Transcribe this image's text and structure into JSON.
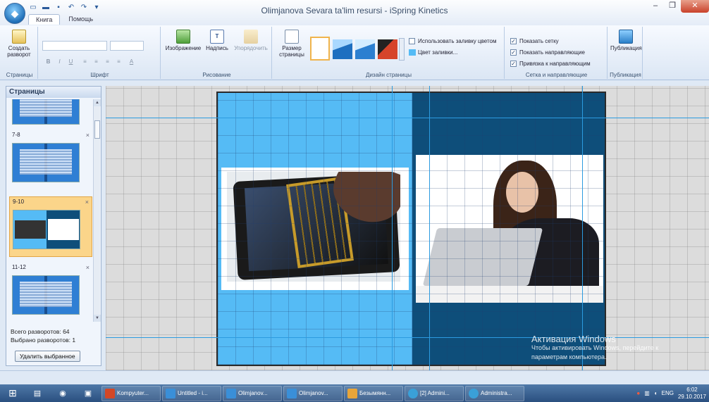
{
  "window": {
    "title": "Olimjanova Sevara ta'lim resursi - iSpring Kinetics",
    "min_label": "–",
    "max_label": "❐",
    "close_label": "✕"
  },
  "tabs": [
    "Книга",
    "Помощь"
  ],
  "ribbon": {
    "create_spread": "Создать разворот",
    "group_pages": "Страницы",
    "group_font": "Шрифт",
    "font_buttons": [
      "B",
      "I",
      "U"
    ],
    "image": "Изображение",
    "textbox": "Надпись",
    "arrange": "Упорядочить",
    "group_drawing": "Рисование",
    "page_size": "Размер страницы",
    "use_fill_color": "Использовать заливку цветом",
    "fill_color": "Цвет заливки...",
    "group_page_design": "Дизайн страницы",
    "show_grid": "Показать сетку",
    "show_guides": "Показать направляющие",
    "snap_guides": "Привязка к направляющим",
    "group_grid": "Сетка и направляющие",
    "publish": "Публикация",
    "group_publish": "Публикация"
  },
  "pages_panel": {
    "header": "Страницы",
    "items": [
      {
        "label": "7-8"
      },
      {
        "label": "9-10"
      },
      {
        "label": "11-12"
      }
    ],
    "close_glyph": "×",
    "total": "Всего разворотов: 64",
    "selected": "Выбрано разворотов: 1",
    "delete_button": "Удалить выбранное"
  },
  "watermark": {
    "line1": "Активация Windows",
    "line2": "Чтобы активировать Windows, перейдите к",
    "line3": "параметрам компьютера."
  },
  "taskbar": {
    "items": [
      {
        "label": "Kompyuter...",
        "color": "#d24726"
      },
      {
        "label": "Untitled - i...",
        "color": "#3a8fd8"
      },
      {
        "label": "Olimjanov...",
        "color": "#3a8fd8"
      },
      {
        "label": "Olimjanov...",
        "color": "#3a8fd8"
      },
      {
        "label": "Безымянн...",
        "color": "#e8a53a"
      },
      {
        "label": "[2] Admini...",
        "color": "#3aa0d8"
      },
      {
        "label": "Administra...",
        "color": "#3aa0d8"
      }
    ],
    "lang": "ENG",
    "time": "6:02",
    "date": "29.10.2017"
  },
  "colors": {
    "left_page": "#55bbf5",
    "right_page": "#0e4e7a",
    "guide": "#2c9be0",
    "selection": "#fbd58a"
  }
}
